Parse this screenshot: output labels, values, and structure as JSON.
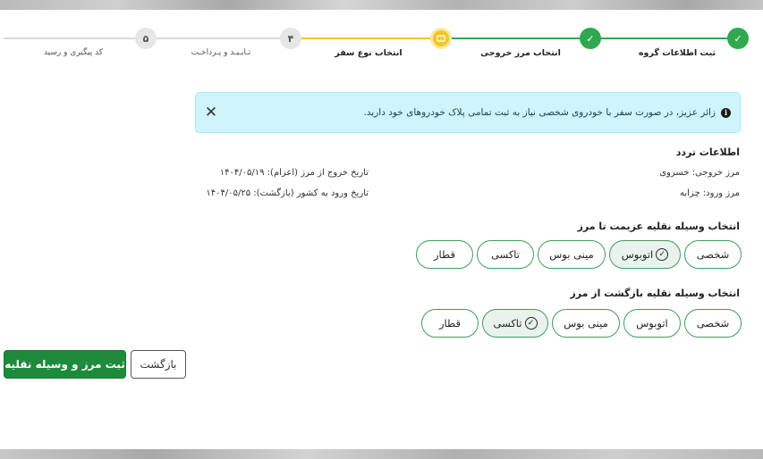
{
  "stepper": {
    "steps": [
      {
        "number": "",
        "label": "ثبت اطلاعات گروه",
        "status": "done"
      },
      {
        "number": "",
        "label": "انتخاب مرز خروجی",
        "status": "done"
      },
      {
        "number": "",
        "label": "انتخاب نوع سفر",
        "status": "active"
      },
      {
        "number": "۴",
        "label": "تـایـیـد و پـرداخـت",
        "status": "pending"
      },
      {
        "number": "۵",
        "label": "کد پیگیری و رسید",
        "status": "pending"
      }
    ],
    "check_glyph": "✓"
  },
  "alert": {
    "text": "زائر عزیز، در صورت سفر با خودروی شخصی نیاز به ثبت تمامی پلاک خودروهای خود دارید.",
    "info_glyph": "i",
    "close_glyph": "✕"
  },
  "travel_info": {
    "title": "اطلاعات تردد",
    "exit_border": "مرز خروجی: خسروی",
    "entry_border": "مرز ورود: چزابه",
    "exit_date": "تاریخ خروج از مرز (اعزام): ۱۴۰۴/۰۵/۱۹",
    "entry_date": "تاریخ ورود به کشور (بازگشت): ۱۴۰۴/۰۵/۲۵"
  },
  "departure_vehicle": {
    "title": "انتخاب وسیله نقلیه عزیمت تا مرز",
    "options": [
      "شخصی",
      "اتوبوس",
      "مینی بوس",
      "تاکسی",
      "قطار"
    ],
    "selected": "اتوبوس"
  },
  "return_vehicle": {
    "title": "انتخاب وسیله نقلیه بازگشت از مرز",
    "options": [
      "شخصی",
      "اتوبوس",
      "مینی بوس",
      "تاکسی",
      "قطار"
    ],
    "selected": "تاکسی"
  },
  "actions": {
    "submit_label": "ثبت مرز و وسیله نقلیه",
    "back_label": "بازگشت"
  },
  "colors": {
    "green": "#2fa84f",
    "yellow": "#f3c623",
    "alert_bg": "#cff4fc",
    "primary_button": "#1e8a3c"
  }
}
